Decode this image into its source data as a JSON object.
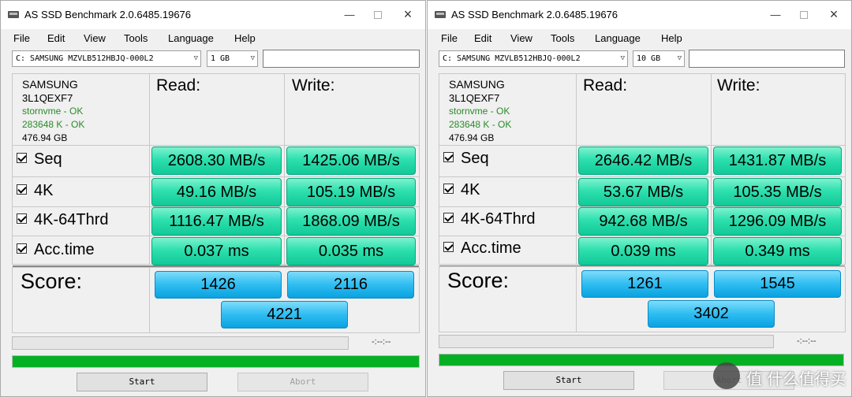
{
  "windows": [
    {
      "title": "AS SSD Benchmark 2.0.6485.19676",
      "menu": [
        "File",
        "Edit",
        "View",
        "Tools",
        "Language",
        "Help"
      ],
      "drive": "C: SAMSUNG MZVLB512HBJQ-000L2",
      "size": "1 GB",
      "info": {
        "model": "SAMSUNG",
        "firmware": "3L1QEXF7",
        "driver": "stornvme - OK",
        "alignment": "283648 K - OK",
        "capacity": "476.94 GB"
      },
      "headers": {
        "read": "Read:",
        "write": "Write:"
      },
      "rows": [
        {
          "label": "Seq",
          "read": "2608.30 MB/s",
          "write": "1425.06 MB/s"
        },
        {
          "label": "4K",
          "read": "49.16 MB/s",
          "write": "105.19 MB/s"
        },
        {
          "label": "4K-64Thrd",
          "read": "1116.47 MB/s",
          "write": "1868.09 MB/s"
        },
        {
          "label": "Acc.time",
          "read": "0.037 ms",
          "write": "0.035 ms"
        }
      ],
      "score_label": "Score:",
      "score": {
        "read": "1426",
        "write": "2116",
        "total": "4221"
      },
      "time": "-:--:--",
      "start": "Start",
      "abort": "Abort"
    },
    {
      "title": "AS SSD Benchmark 2.0.6485.19676",
      "menu": [
        "File",
        "Edit",
        "View",
        "Tools",
        "Language",
        "Help"
      ],
      "drive": "C: SAMSUNG MZVLB512HBJQ-000L2",
      "size": "10 GB",
      "info": {
        "model": "SAMSUNG",
        "firmware": "3L1QEXF7",
        "driver": "stornvme - OK",
        "alignment": "283648 K - OK",
        "capacity": "476.94 GB"
      },
      "headers": {
        "read": "Read:",
        "write": "Write:"
      },
      "rows": [
        {
          "label": "Seq",
          "read": "2646.42 MB/s",
          "write": "1431.87 MB/s"
        },
        {
          "label": "4K",
          "read": "53.67 MB/s",
          "write": "105.35 MB/s"
        },
        {
          "label": "4K-64Thrd",
          "read": "942.68 MB/s",
          "write": "1296.09 MB/s"
        },
        {
          "label": "Acc.time",
          "read": "0.039 ms",
          "write": "0.349 ms"
        }
      ],
      "score_label": "Score:",
      "score": {
        "read": "1261",
        "write": "1545",
        "total": "3402"
      },
      "time": "-:--:--",
      "start": "Start",
      "abort": "Abort"
    }
  ],
  "watermark": "值 什么值得买",
  "colors": {
    "value_green": "#2de0ae",
    "score_blue": "#2ebdf1",
    "progress_green": "#06b025"
  }
}
